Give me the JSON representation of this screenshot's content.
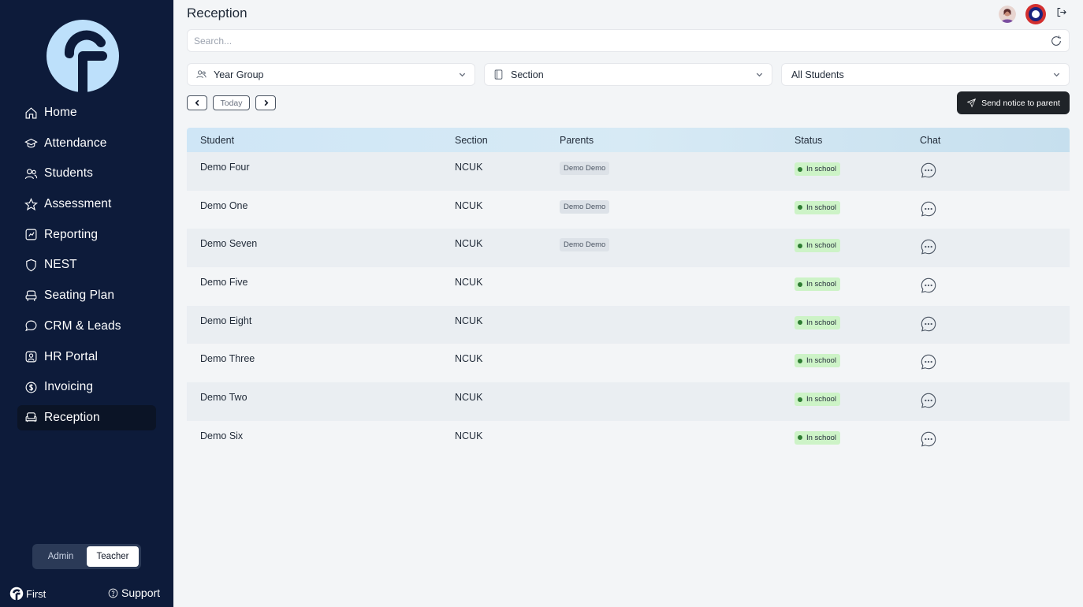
{
  "sidebar": {
    "items": [
      {
        "label": "Home",
        "icon": "home-icon"
      },
      {
        "label": "Attendance",
        "icon": "attendance-icon"
      },
      {
        "label": "Students",
        "icon": "students-icon"
      },
      {
        "label": "Assessment",
        "icon": "star-icon"
      },
      {
        "label": "Reporting",
        "icon": "report-icon"
      },
      {
        "label": "NEST",
        "icon": "shield-icon"
      },
      {
        "label": "Seating Plan",
        "icon": "seat-icon"
      },
      {
        "label": "CRM & Leads",
        "icon": "chat-bubble-icon"
      },
      {
        "label": "HR Portal",
        "icon": "user-badge-icon"
      },
      {
        "label": "Invoicing",
        "icon": "dollar-icon"
      },
      {
        "label": "Reception",
        "icon": "sofa-icon",
        "active": true
      }
    ],
    "role_toggle": {
      "admin": "Admin",
      "teacher": "Teacher",
      "selected": "Teacher"
    },
    "brand": "First",
    "support": "Support"
  },
  "header": {
    "title": "Reception"
  },
  "search": {
    "placeholder": "Search..."
  },
  "filters": {
    "year_group": "Year Group",
    "section": "Section",
    "students": "All Students"
  },
  "date_nav": {
    "today": "Today"
  },
  "actions": {
    "send_notice": "Send notice to parent"
  },
  "table": {
    "columns": [
      "Student",
      "Section",
      "Parents",
      "Status",
      "Chat"
    ],
    "rows": [
      {
        "student": "Demo Four",
        "section": "NCUK",
        "parent": "Demo Demo",
        "status": "In school"
      },
      {
        "student": "Demo One",
        "section": "NCUK",
        "parent": "Demo Demo",
        "status": "In school"
      },
      {
        "student": "Demo Seven",
        "section": "NCUK",
        "parent": "Demo Demo",
        "status": "In school"
      },
      {
        "student": "Demo Five",
        "section": "NCUK",
        "parent": "",
        "status": "In school"
      },
      {
        "student": "Demo Eight",
        "section": "NCUK",
        "parent": "",
        "status": "In school"
      },
      {
        "student": "Demo Three",
        "section": "NCUK",
        "parent": "",
        "status": "In school"
      },
      {
        "student": "Demo Two",
        "section": "NCUK",
        "parent": "",
        "status": "In school"
      },
      {
        "student": "Demo Six",
        "section": "NCUK",
        "parent": "",
        "status": "In school"
      }
    ]
  },
  "colors": {
    "sidebar_bg": "#0d1b3a",
    "logo": "#bde0fb",
    "status_green": "#cdf3c7",
    "send_button": "#1f2328"
  }
}
